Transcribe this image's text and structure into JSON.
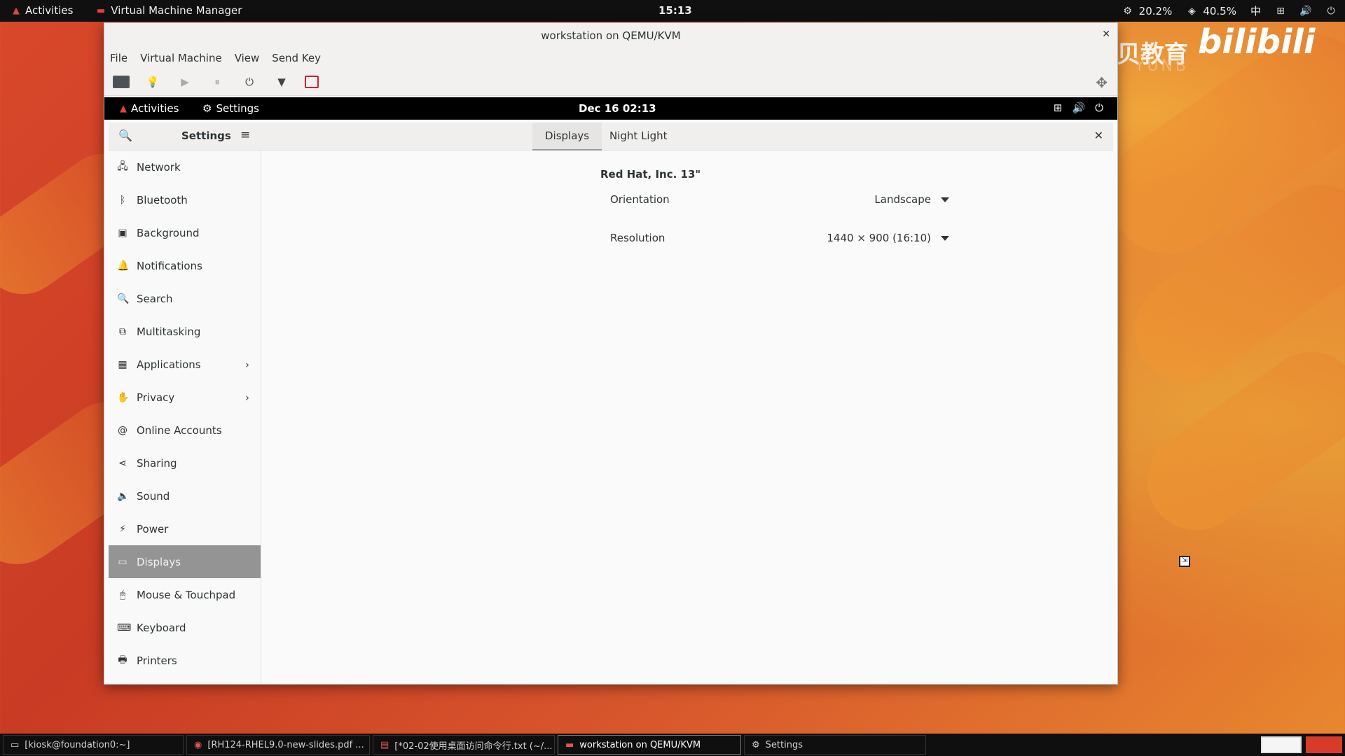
{
  "host": {
    "topbar": {
      "activities": "Activities",
      "app_name": "Virtual Machine Manager",
      "clock": "15:13",
      "cpu": "20.2%",
      "mem": "40.5%",
      "ime": "中"
    },
    "taskbar": {
      "tasks": [
        {
          "label": "[kiosk@foundation0:~]",
          "icon": "terminal-icon"
        },
        {
          "label": "[RH124-RHEL9.0-new-slides.pdf ...",
          "icon": "pdf-icon"
        },
        {
          "label": "[*02-02使用桌面访问命令行.txt (~/...",
          "icon": "text-editor-icon"
        },
        {
          "label": "workstation on QEMU/KVM",
          "icon": "vm-icon"
        },
        {
          "label": "Settings",
          "icon": "gear-icon"
        }
      ]
    }
  },
  "vm": {
    "title": "workstation on QEMU/KVM",
    "menu": [
      "File",
      "Virtual Machine",
      "View",
      "Send Key"
    ]
  },
  "guest": {
    "topbar": {
      "activities": "Activities",
      "app": "Settings",
      "datetime": "Dec 16  02:13"
    },
    "settings": {
      "title": "Settings",
      "tabs": [
        "Displays",
        "Night Light"
      ],
      "sidebar": [
        {
          "label": "Network",
          "icon": "network-icon"
        },
        {
          "label": "Bluetooth",
          "icon": "bluetooth-icon"
        },
        {
          "label": "Background",
          "icon": "background-icon"
        },
        {
          "label": "Notifications",
          "icon": "bell-icon"
        },
        {
          "label": "Search",
          "icon": "search-icon"
        },
        {
          "label": "Multitasking",
          "icon": "multitasking-icon"
        },
        {
          "label": "Applications",
          "icon": "grid-icon"
        },
        {
          "label": "Privacy",
          "icon": "hand-icon"
        },
        {
          "label": "Online Accounts",
          "icon": "at-icon"
        },
        {
          "label": "Sharing",
          "icon": "share-icon"
        },
        {
          "label": "Sound",
          "icon": "speaker-icon"
        },
        {
          "label": "Power",
          "icon": "power-icon"
        },
        {
          "label": "Displays",
          "icon": "display-icon"
        },
        {
          "label": "Mouse & Touchpad",
          "icon": "mouse-icon"
        },
        {
          "label": "Keyboard",
          "icon": "keyboard-icon"
        },
        {
          "label": "Printers",
          "icon": "printer-icon"
        }
      ],
      "selected": "Displays",
      "display": {
        "monitor": "Red Hat, Inc. 13\"",
        "orientation_label": "Orientation",
        "orientation_value": "Landscape",
        "resolution_label": "Resolution",
        "resolution_value": "1440 × 900 (16:10)"
      }
    }
  },
  "watermark": {
    "cn": "云贝教育",
    "brand": "bilibili",
    "sub": "YUNB"
  }
}
